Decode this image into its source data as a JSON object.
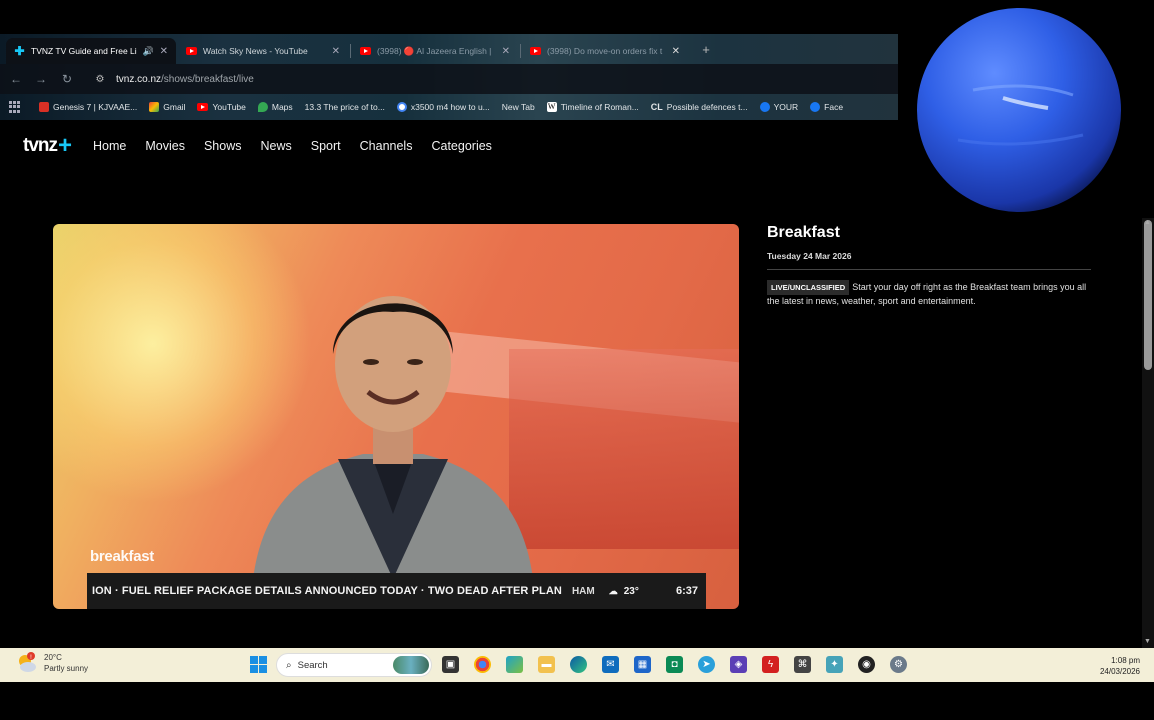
{
  "browser": {
    "tabs": [
      {
        "title": "TVNZ TV Guide and Free Li",
        "active": true,
        "favicon": "tvnz-plus-icon",
        "audio": true
      },
      {
        "title": "Watch Sky News - YouTube",
        "active": false,
        "favicon": "youtube-icon"
      },
      {
        "title": "(3998) 🔴 Al Jazeera English |",
        "active": false,
        "favicon": "youtube-icon"
      },
      {
        "title": "(3998) Do move-on orders fix t",
        "active": false,
        "favicon": "youtube-icon"
      }
    ],
    "new_tab_label": "+",
    "address": {
      "host": "tvnz.co.nz",
      "path": "/shows/breakfast/live"
    },
    "bookmarks": [
      {
        "label": "Genesis 7 | KJVAAE...",
        "icon": "bookmark-red-icon",
        "color": "#d93025"
      },
      {
        "label": "Gmail",
        "icon": "gmail-icon",
        "color": "#ea4335"
      },
      {
        "label": "YouTube",
        "icon": "youtube-icon",
        "color": "#ff0000"
      },
      {
        "label": "Maps",
        "icon": "maps-icon",
        "color": "#34a853"
      },
      {
        "label": "13.3 The price of to...",
        "icon": "none",
        "color": ""
      },
      {
        "label": "x3500 m4 how to u...",
        "icon": "google-icon",
        "color": "#4285f4"
      },
      {
        "label": "New Tab",
        "icon": "none",
        "color": ""
      },
      {
        "label": "Timeline of Roman...",
        "icon": "wikipedia-icon",
        "color": "#ffffff"
      },
      {
        "label": "Possible defences t...",
        "icon": "cl-icon",
        "color": "#ffffff"
      },
      {
        "label": "YOUR",
        "icon": "facebook-icon",
        "color": "#1877f2"
      },
      {
        "label": "Face",
        "icon": "facebook-icon",
        "color": "#1877f2"
      }
    ]
  },
  "site": {
    "logo": "tvnz",
    "logo_plus": "+",
    "nav": [
      "Home",
      "Movies",
      "Shows",
      "News",
      "Sport",
      "Channels",
      "Categories"
    ]
  },
  "player": {
    "show_bug": "breakfast",
    "ticker_headline": "ION · FUEL RELIEF PACKAGE DETAILS ANNOUNCED TODAY · TWO DEAD AFTER PLAN",
    "ticker_location": "HAM",
    "ticker_weather_icon": "cloud-icon",
    "ticker_temp": "23°",
    "ticker_time": "6:37"
  },
  "info": {
    "title": "Breakfast",
    "date": "Tuesday 24 Mar 2026",
    "badge": "LIVE/UNCLASSIFIED",
    "description": "Start your day off right as the Breakfast team brings you all the latest in news, weather, sport and entertainment."
  },
  "taskbar": {
    "weather_temp": "20°C",
    "weather_desc": "Partly sunny",
    "weather_alert": "!",
    "search_placeholder": "Search",
    "time": "1:08 pm",
    "date": "24/03/2026"
  },
  "colors": {
    "tvnz_accent": "#18c7f5",
    "taskbar_bg": "#f3efd8",
    "start_blue": "#1a8fe3"
  }
}
